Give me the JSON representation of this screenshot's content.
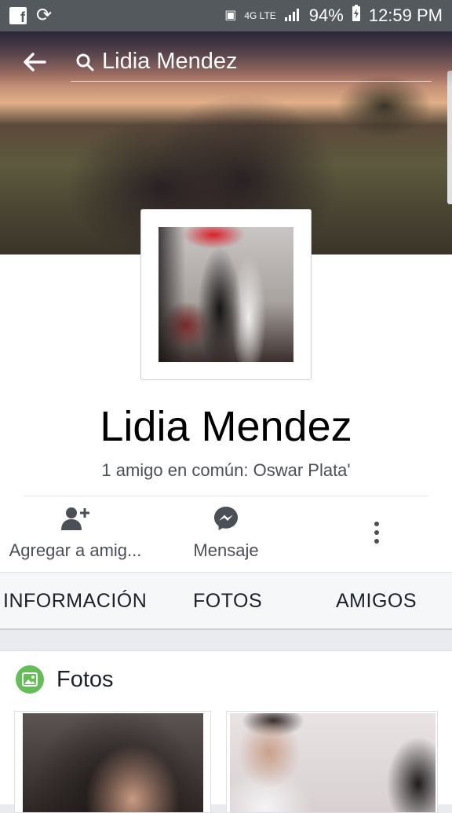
{
  "status_bar": {
    "battery": "94%",
    "time": "12:59 PM",
    "network": "4G LTE",
    "icons": [
      "facebook-icon",
      "sync-icon",
      "nfc-icon",
      "signal-icon",
      "battery-charging-icon"
    ]
  },
  "search": {
    "query": "Lidia Mendez"
  },
  "profile": {
    "name": "Lidia Mendez",
    "mutual_friends": "1 amigo en común: Oswar Plata'"
  },
  "actions": {
    "add_friend": "Agregar a amig...",
    "message": "Mensaje"
  },
  "tabs": {
    "info": "INFORMACIÓN",
    "photos": "FOTOS",
    "friends": "AMIGOS"
  },
  "photos_section": {
    "title": "Fotos"
  },
  "colors": {
    "status_bar": "#54595e",
    "photo_badge": "#63be58",
    "tabs_background": "#f6f7f9"
  }
}
